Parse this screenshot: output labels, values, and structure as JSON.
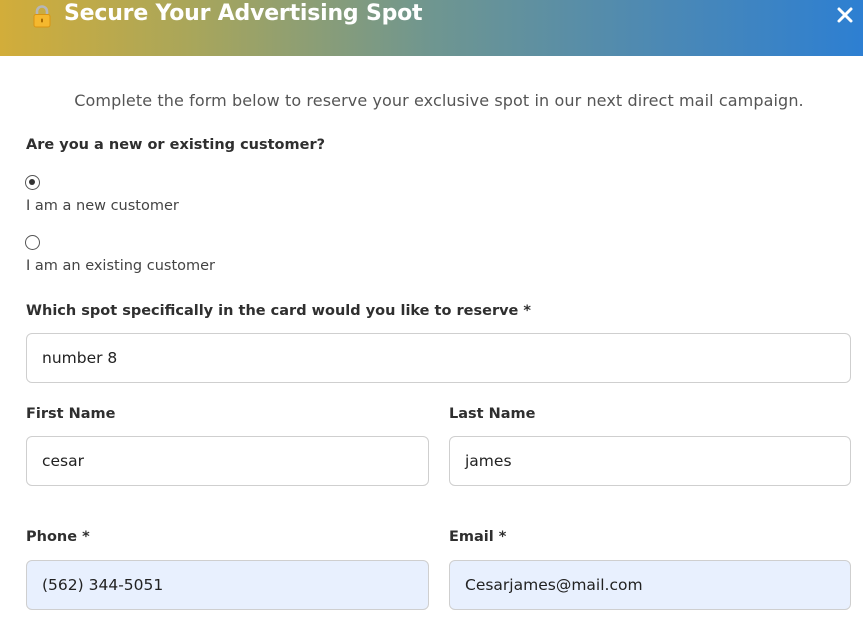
{
  "dialog": {
    "title": "Secure Your Advertising Spot",
    "lock_icon": "lock-icon",
    "close_icon": "close-icon",
    "accent_gradient": [
      "#d2ad3a",
      "#6f9690",
      "#2d7fd2"
    ]
  },
  "intro": "Complete the form below to reserve your exclusive spot in our next direct mail campaign.",
  "customer_question": {
    "label": "Are you a new or existing customer?",
    "options": [
      {
        "label": "I am a new customer",
        "selected": true
      },
      {
        "label": "I am an existing customer",
        "selected": false
      }
    ]
  },
  "spot": {
    "label": "Which spot specifically in the card would you like to reserve *",
    "value": "number 8"
  },
  "first_name": {
    "label": "First Name",
    "value": "cesar"
  },
  "last_name": {
    "label": "Last Name",
    "value": "james"
  },
  "phone": {
    "label": "Phone *",
    "value": "(562) 344-5051"
  },
  "email": {
    "label": "Email *",
    "value": "Cesarjames@mail.com"
  }
}
